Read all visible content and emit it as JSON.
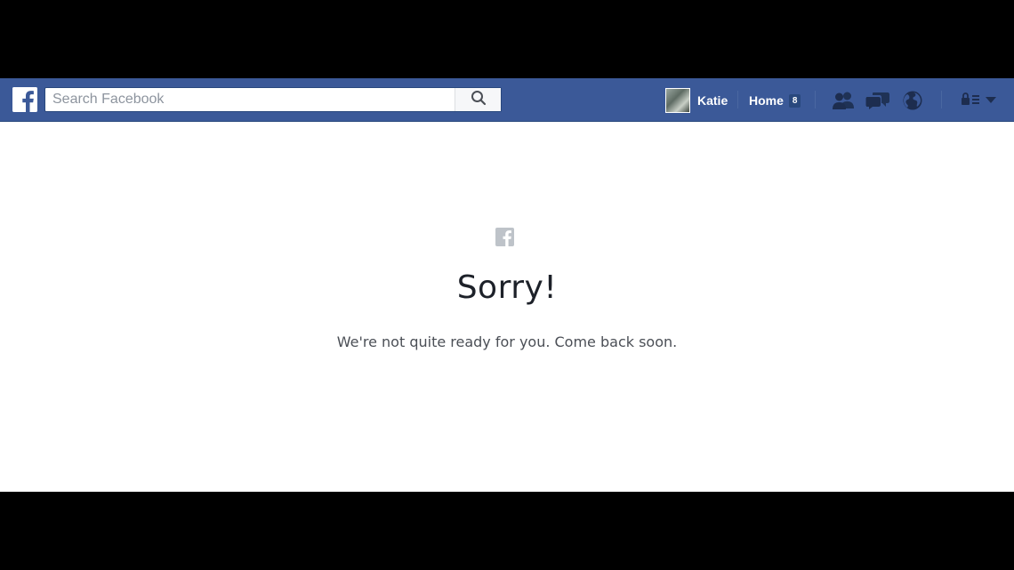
{
  "header": {
    "search": {
      "placeholder": "Search Facebook"
    },
    "profile": {
      "name": "Katie"
    },
    "home": {
      "label": "Home",
      "count": "8"
    },
    "icons": {
      "logo": "facebook-logo-icon",
      "search": "search-icon",
      "friends": "friend-requests-icon",
      "messages": "messages-icon",
      "notifications": "notifications-globe-icon",
      "privacy": "privacy-lock-icon",
      "account": "account-dropdown-icon"
    }
  },
  "main": {
    "heading": "Sorry!",
    "message": "We're not quite ready for you. Come back soon."
  },
  "colors": {
    "brand_blue": "#3b5998",
    "page_background": "#ffffff",
    "letterbox": "#000000",
    "muted_logo": "#bec3c9"
  }
}
